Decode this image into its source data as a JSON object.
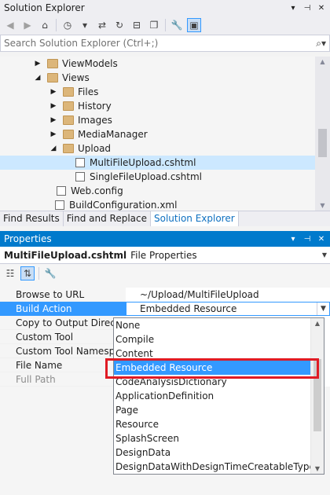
{
  "solution_explorer": {
    "title": "Solution Explorer",
    "header_buttons": [
      "▾",
      "⊣",
      "✕"
    ],
    "search_placeholder": "Search Solution Explorer (Ctrl+;)",
    "tree": [
      {
        "label": "ViewModels",
        "type": "folder",
        "expand": "▶",
        "depth": 3,
        "selected": false
      },
      {
        "label": "Views",
        "type": "folder",
        "expand": "◢",
        "depth": 3,
        "selected": false
      },
      {
        "label": "Files",
        "type": "folder",
        "expand": "▶",
        "depth": 4,
        "selected": false
      },
      {
        "label": "History",
        "type": "folder",
        "expand": "▶",
        "depth": 4,
        "selected": false
      },
      {
        "label": "Images",
        "type": "folder",
        "expand": "▶",
        "depth": 4,
        "selected": false
      },
      {
        "label": "MediaManager",
        "type": "folder",
        "expand": "▶",
        "depth": 4,
        "selected": false
      },
      {
        "label": "Upload",
        "type": "folder",
        "expand": "◢",
        "depth": 4,
        "selected": false
      },
      {
        "label": "MultiFileUpload.cshtml",
        "type": "file",
        "expand": "",
        "depth": 5,
        "selected": true
      },
      {
        "label": "SingleFileUpload.cshtml",
        "type": "file",
        "expand": "",
        "depth": 5,
        "selected": false
      },
      {
        "label": "Web.config",
        "type": "file",
        "expand": "",
        "depth": 4,
        "selected": false
      },
      {
        "label": "BuildConfiguration.xml",
        "type": "file",
        "expand": "",
        "depth": 2,
        "selected": false
      }
    ]
  },
  "tabs": [
    {
      "label": "Find Results",
      "active": false
    },
    {
      "label": "Find and Replace",
      "active": false
    },
    {
      "label": "Solution Explorer",
      "active": true
    }
  ],
  "properties": {
    "title": "Properties",
    "header_buttons": [
      "▾",
      "⊣",
      "✕"
    ],
    "object_name": "MultiFileUpload.cshtml",
    "object_type": "File Properties",
    "rows": [
      {
        "name": "Browse to URL",
        "value": "~/Upload/MultiFileUpload",
        "selected": false,
        "dim": false
      },
      {
        "name": "Build Action",
        "value": "Embedded Resource",
        "selected": true,
        "dim": false
      },
      {
        "name": "Copy to Output Directo",
        "value": "",
        "selected": false,
        "dim": false
      },
      {
        "name": "Custom Tool",
        "value": "",
        "selected": false,
        "dim": false
      },
      {
        "name": "Custom Tool Namespa",
        "value": "",
        "selected": false,
        "dim": false
      },
      {
        "name": "File Name",
        "value": "",
        "selected": false,
        "dim": false
      },
      {
        "name": "Full Path",
        "value": "",
        "selected": false,
        "dim": true
      }
    ],
    "dropdown_options": [
      "None",
      "Compile",
      "Content",
      "Embedded Resource",
      "CodeAnalysisDictionary",
      "ApplicationDefinition",
      "Page",
      "Resource",
      "SplashScreen",
      "DesignData",
      "DesignDataWithDesignTimeCreatableTypes"
    ],
    "dropdown_selected": "Embedded Resource"
  },
  "colors": {
    "accent": "#007acc",
    "selection": "#3399ff",
    "highlight_box": "#e01b24"
  }
}
